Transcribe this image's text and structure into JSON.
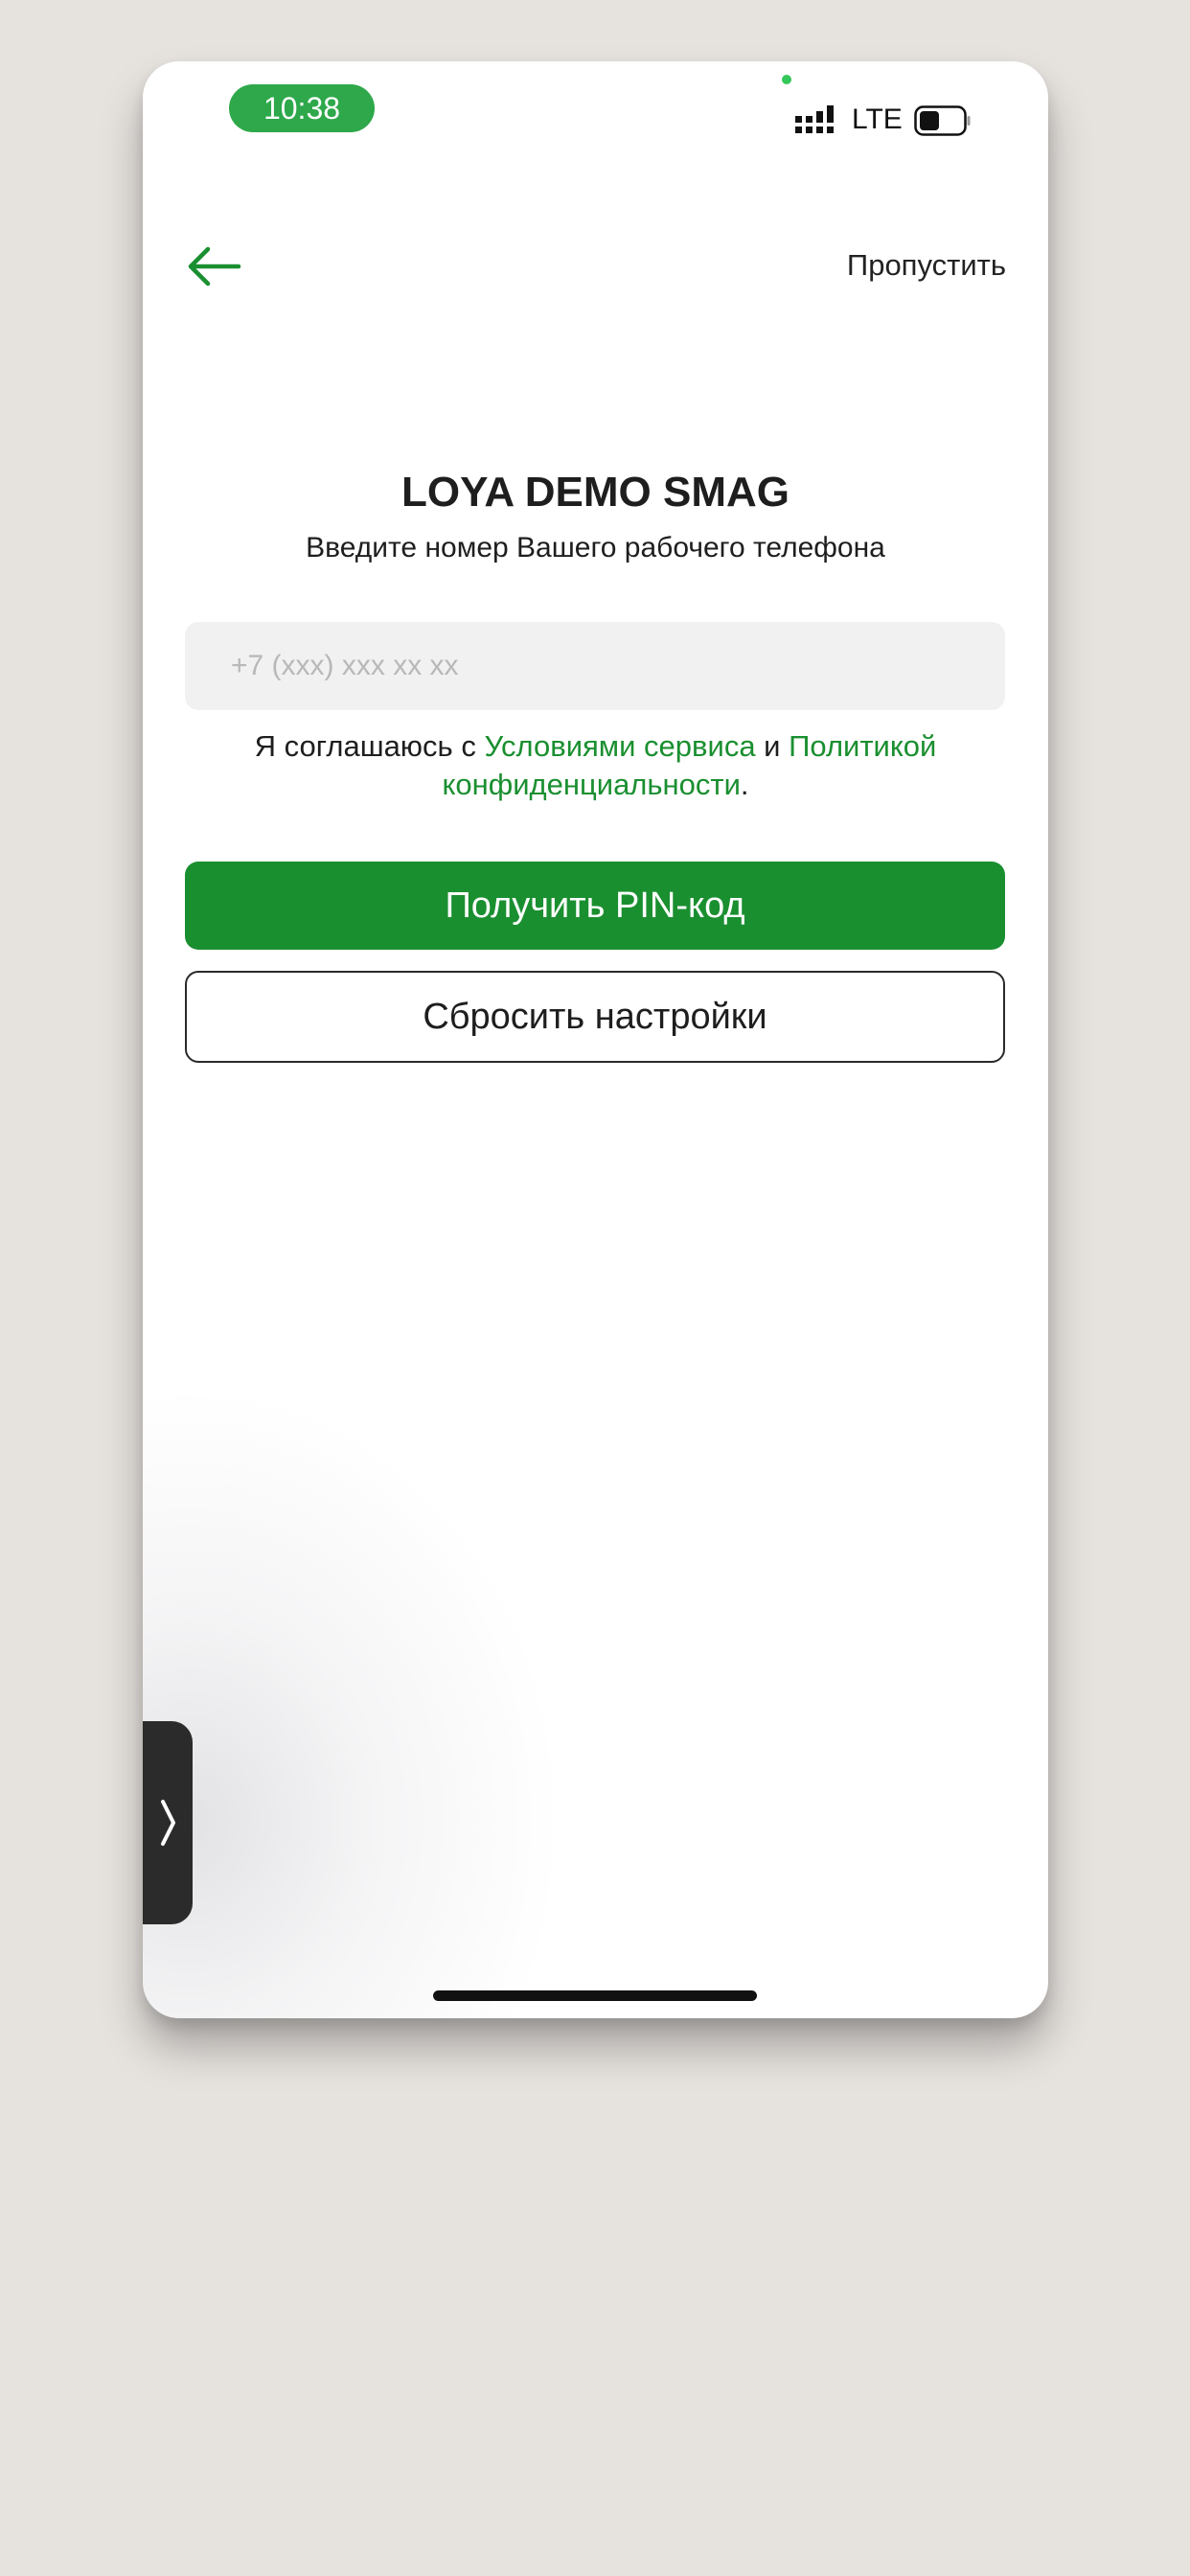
{
  "status_bar": {
    "time": "10:38",
    "network": "LTE",
    "icons": [
      "signal-icon",
      "battery-icon"
    ]
  },
  "nav": {
    "back_icon": "arrow-left-icon",
    "skip_label": "Пропустить"
  },
  "header": {
    "title": "LOYA DEMO SMAG",
    "subtitle": "Введите номер Вашего рабочего телефона"
  },
  "form": {
    "phone_placeholder": "+7 (xxx) xxx xx xx",
    "phone_value": ""
  },
  "consent": {
    "prefix": "Я соглашаюсь с ",
    "terms_link": "Условиями сервиса",
    "and": " и ",
    "policy_link": "Политикой конфиденциальности",
    "suffix": "."
  },
  "actions": {
    "get_pin_label": "Получить PIN-код",
    "reset_label": "Сбросить настройки"
  },
  "side_panel": {
    "icon": "chevron-right-icon"
  },
  "colors": {
    "accent": "#1a8f30",
    "time_pill": "#2ea84a",
    "input_bg": "#f1f1f1",
    "backdrop": "#e6e2de"
  }
}
